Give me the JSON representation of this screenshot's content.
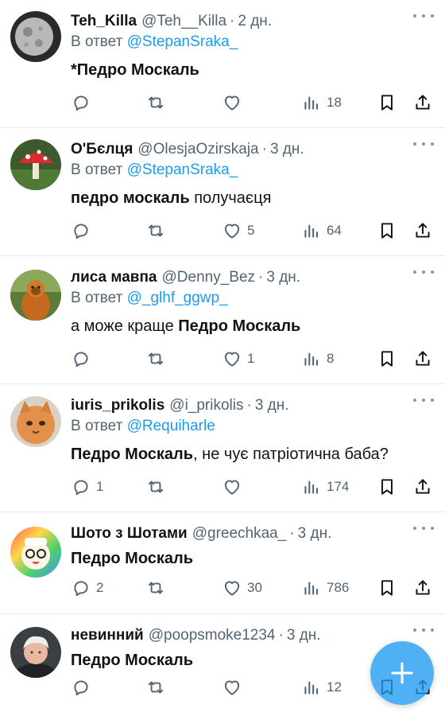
{
  "tweets": [
    {
      "name": "Teh_Killa",
      "handle": "@Teh__Killa",
      "time": "2 дн.",
      "reply_prefix": "В ответ ",
      "reply_to": "@StepanSraka_",
      "text_bold": "*Педро Москаль",
      "text_rest": "",
      "replies": "",
      "likes": "",
      "views": "18",
      "avatar": "moon-avatar"
    },
    {
      "name": "О'Бєлця",
      "handle": "@OlesjaOzirskaja",
      "time": "3 дн.",
      "reply_prefix": "В ответ ",
      "reply_to": "@StepanSraka_",
      "text_bold": "педро москаль",
      "text_rest": " получаєця",
      "replies": "",
      "likes": "5",
      "views": "64",
      "avatar": "mushroom-avatar"
    },
    {
      "name": "лиса мавпа",
      "handle": "@Denny_Bez",
      "time": "3 дн.",
      "reply_prefix": "В ответ ",
      "reply_to": "@_glhf_ggwp_",
      "text_pre": "а може краще ",
      "text_bold": "Педро Москаль",
      "text_rest": "",
      "replies": "",
      "likes": "1",
      "views": "8",
      "avatar": "orangutan-avatar"
    },
    {
      "name": "iuris_prikolis",
      "handle": "@i_prikolis",
      "time": "3 дн.",
      "reply_prefix": "В ответ ",
      "reply_to": "@Requiharle",
      "text_bold": "Педро Москаль",
      "text_rest": ", не чує патріотична баба?",
      "replies": "1",
      "likes": "",
      "views": "174",
      "avatar": "cat-avatar"
    },
    {
      "name": "Шото з Шотами",
      "handle": "@greechkaa_",
      "time": "3 дн.",
      "text_bold": "Педро Москаль",
      "text_rest": "",
      "replies": "2",
      "likes": "30",
      "views": "786",
      "avatar": "character-avatar"
    },
    {
      "name": "невинний",
      "handle": "@poopsmoke1234",
      "time": "3 дн.",
      "text_bold": "Педро Москаль",
      "text_rest": "",
      "replies": "",
      "likes": "",
      "views": "12",
      "avatar": "man-avatar"
    }
  ],
  "colors": {
    "accent": "#1d9bf0",
    "muted": "#536471",
    "text": "#0f1419",
    "fab": "#1d9bf0"
  },
  "icons": [
    "reply-icon",
    "retweet-icon",
    "like-icon",
    "views-icon",
    "bookmark-icon",
    "share-icon",
    "compose-icon",
    "more-icon"
  ]
}
